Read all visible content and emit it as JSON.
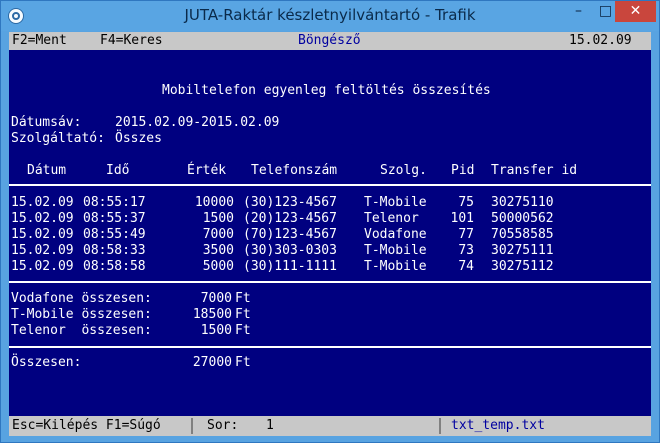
{
  "window": {
    "title": "JUTA-Raktár készletnyilvántartó - Trafik",
    "minimize": "–",
    "maximize": "□",
    "close": "✕"
  },
  "topbar": {
    "hint_save": "F2=Ment",
    "hint_search": "F4=Keres",
    "mode": "Böngésző",
    "date": "15.02.09"
  },
  "report": {
    "title": "Mobiltelefon egyenleg feltöltés összesítés",
    "date_range_label": "Dátumsáv:",
    "date_range_value": "2015.02.09-2015.02.09",
    "provider_label": "Szolgáltató:",
    "provider_value": "Összes",
    "columns": [
      "Dátum",
      "Idő",
      "Érték",
      "Telefonszám",
      "Szolg.",
      "Pid",
      "Transfer id"
    ],
    "rows": [
      [
        "15.02.09",
        "08:55:17",
        "10000",
        "(30)123-4567",
        "T-Mobile",
        "75",
        "30275110"
      ],
      [
        "15.02.09",
        "08:55:37",
        "1500",
        "(20)123-4567",
        "Telenor",
        "101",
        "50000562"
      ],
      [
        "15.02.09",
        "08:55:49",
        "7000",
        "(70)123-4567",
        "Vodafone",
        "77",
        "70558585"
      ],
      [
        "15.02.09",
        "08:58:33",
        "3500",
        "(30)303-0303",
        "T-Mobile",
        "73",
        "30275111"
      ],
      [
        "15.02.09",
        "08:58:58",
        "5000",
        "(30)111-1111",
        "T-Mobile",
        "74",
        "30275112"
      ]
    ],
    "totals": [
      {
        "label": "Vodafone összesen:",
        "value": "7000",
        "unit": "Ft"
      },
      {
        "label": "T-Mobile összesen:",
        "value": "18500",
        "unit": "Ft"
      },
      {
        "label": "Telenor  összesen:",
        "value": "1500",
        "unit": "Ft"
      }
    ],
    "grand_total": {
      "label": "Összesen:",
      "value": "27000",
      "unit": "Ft"
    }
  },
  "statusbar": {
    "keys": "Esc=Kilépés F1=Súgó",
    "row_label": "Sor:",
    "row_value": "1",
    "file": "txt_temp.txt"
  },
  "colors": {
    "background": "#000080",
    "text": "#ffffff",
    "bar": "#c8c8c8",
    "accent": "#0000a0"
  }
}
